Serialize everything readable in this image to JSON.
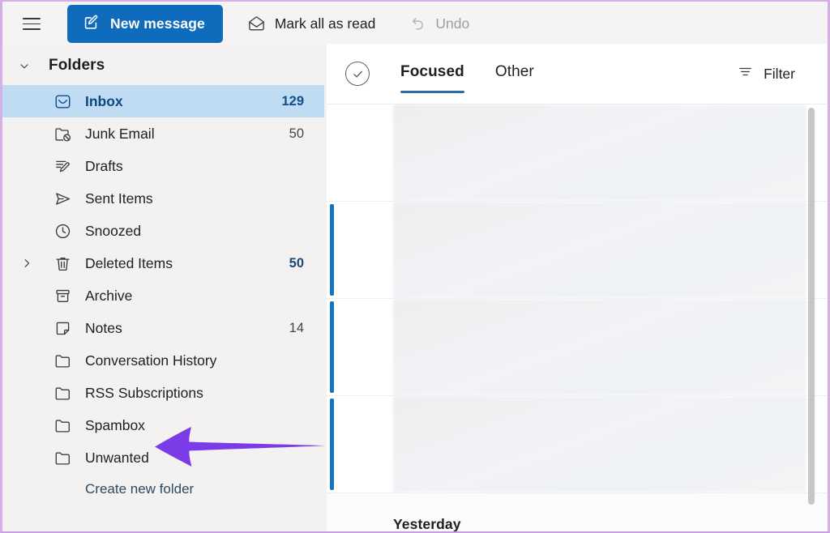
{
  "toolbar": {
    "menu_icon": "hamburger-menu-icon",
    "new_message": {
      "label": "New message",
      "icon": "compose-icon",
      "bg": "#0f6cbd"
    },
    "mark_all_read": {
      "label": "Mark all as read",
      "icon": "envelope-icon"
    },
    "undo": {
      "label": "Undo",
      "icon": "undo-arrow-icon",
      "disabled": true
    }
  },
  "sidebar": {
    "header": {
      "title": "Folders",
      "icon": "chevron-down-icon"
    },
    "items": [
      {
        "label": "Inbox",
        "count": "129",
        "icon": "inbox-tray-icon",
        "selected": true
      },
      {
        "label": "Junk Email",
        "count": "50",
        "icon": "junk-folder-icon",
        "selected": false
      },
      {
        "label": "Drafts",
        "count": "",
        "icon": "pencil-draft-icon",
        "selected": false
      },
      {
        "label": "Sent Items",
        "count": "",
        "icon": "paper-plane-icon",
        "selected": false
      },
      {
        "label": "Snoozed",
        "count": "",
        "icon": "clock-icon",
        "selected": false
      },
      {
        "label": "Deleted Items",
        "count": "50",
        "icon": "trash-icon",
        "selected": false,
        "expandable": true,
        "count_accent": true
      },
      {
        "label": "Archive",
        "count": "",
        "icon": "archive-box-icon",
        "selected": false
      },
      {
        "label": "Notes",
        "count": "14",
        "icon": "note-page-icon",
        "selected": false
      },
      {
        "label": "Conversation History",
        "count": "",
        "icon": "folder-icon",
        "selected": false
      },
      {
        "label": "RSS Subscriptions",
        "count": "",
        "icon": "folder-icon",
        "selected": false
      },
      {
        "label": "Spambox",
        "count": "",
        "icon": "folder-icon",
        "selected": false
      },
      {
        "label": "Unwanted",
        "count": "",
        "icon": "folder-icon",
        "selected": false
      }
    ],
    "create_folder": {
      "label": "Create new folder"
    }
  },
  "message_list": {
    "select_all_icon": "check-circle-icon",
    "tabs": [
      {
        "label": "Focused",
        "active": true
      },
      {
        "label": "Other",
        "active": false
      }
    ],
    "filter": {
      "label": "Filter",
      "icon": "filter-lines-icon"
    },
    "date_group": "Yesterday",
    "rows": [
      {
        "unread": false,
        "redacted": true
      },
      {
        "unread": true,
        "redacted": true
      },
      {
        "unread": true,
        "redacted": true
      },
      {
        "unread": true,
        "redacted": true
      }
    ],
    "scrollbar": "vertical-scrollbar"
  },
  "annotation": {
    "arrow": {
      "name": "callout-arrow",
      "color": "#7b3ce8",
      "direction": "left",
      "points_at": "Spambox"
    }
  },
  "colors": {
    "accent_blue": "#0f6cbd",
    "selected_row": "#bfdcf3",
    "unread_bar": "#1275c4",
    "sidebar_bg": "#f3f2f1",
    "annotation_purple": "#7b3ce8",
    "page_border": "#d6aee8"
  }
}
